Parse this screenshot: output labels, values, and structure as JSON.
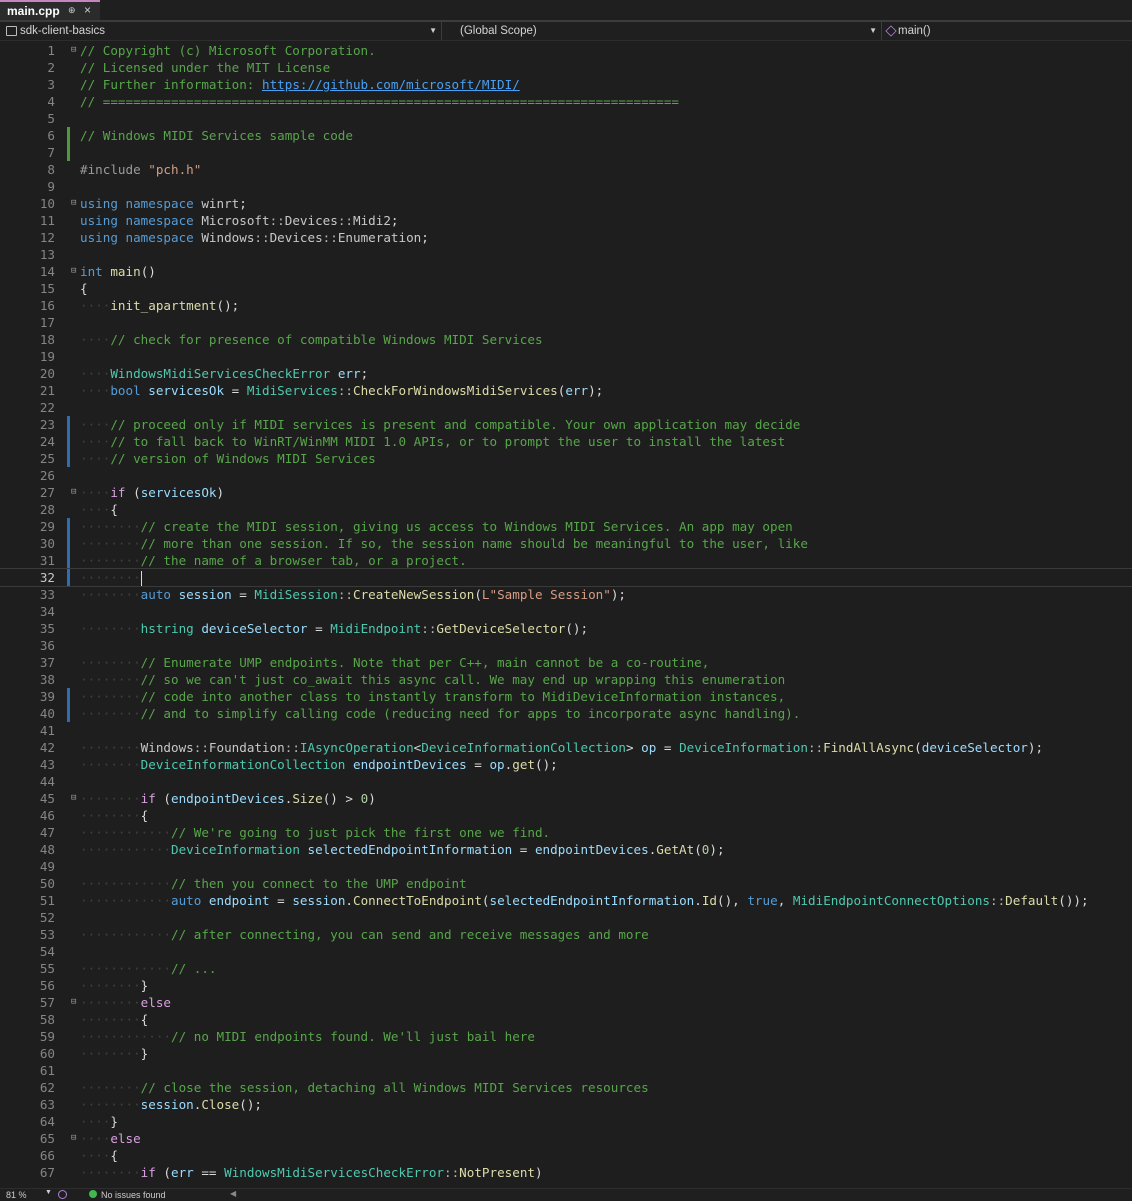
{
  "tab": {
    "title": "main.cpp",
    "pin": "⊕",
    "close": "×"
  },
  "nav": {
    "project": "sdk-client-basics",
    "scope": "(Global Scope)",
    "member": "main()"
  },
  "status": {
    "zoom": "81 %",
    "issues": "No issues found"
  },
  "colors": {
    "comment": "#57a64a",
    "keyword": "#569cd6",
    "control": "#d8a0df",
    "type": "#4ec9b0",
    "function": "#dcdcaa",
    "variable": "#9cdcfe",
    "string": "#d69d85"
  },
  "current_line": 32,
  "lines": [
    [
      [
        "cm",
        "// Copyright (c) Microsoft Corporation."
      ]
    ],
    [
      [
        "cm",
        "// Licensed under the MIT License"
      ]
    ],
    [
      [
        "cm",
        "// Further information: "
      ],
      [
        "link",
        "https://github.com/microsoft/MIDI/"
      ]
    ],
    [
      [
        "cm",
        "// ============================================================================"
      ]
    ],
    [],
    [
      [
        "cm",
        "// Windows MIDI Services sample code"
      ]
    ],
    [],
    [
      [
        "pp",
        "#include "
      ],
      [
        "str",
        "\"pch.h\""
      ]
    ],
    [],
    [
      [
        "kw",
        "using namespace "
      ],
      [
        "nsp",
        "winrt"
      ],
      [
        "plain",
        ";"
      ]
    ],
    [
      [
        "kw",
        "using namespace "
      ],
      [
        "nsp",
        "Microsoft"
      ],
      [
        "op",
        "::"
      ],
      [
        "nsp",
        "Devices"
      ],
      [
        "op",
        "::"
      ],
      [
        "nsp",
        "Midi2"
      ],
      [
        "plain",
        ";"
      ]
    ],
    [
      [
        "kw",
        "using namespace "
      ],
      [
        "nsp",
        "Windows"
      ],
      [
        "op",
        "::"
      ],
      [
        "nsp",
        "Devices"
      ],
      [
        "op",
        "::"
      ],
      [
        "nsp",
        "Enumeration"
      ],
      [
        "plain",
        ";"
      ]
    ],
    [],
    [
      [
        "kw",
        "int "
      ],
      [
        "fn",
        "main"
      ],
      [
        "plain",
        "()"
      ]
    ],
    [
      [
        "plain",
        "{"
      ]
    ],
    [
      [
        "ws",
        "    "
      ],
      [
        "fn",
        "init_apartment"
      ],
      [
        "plain",
        "();"
      ]
    ],
    [],
    [
      [
        "ws",
        "    "
      ],
      [
        "cm",
        "// check for presence of compatible Windows MIDI Services"
      ]
    ],
    [],
    [
      [
        "ws",
        "    "
      ],
      [
        "ty",
        "WindowsMidiServicesCheckError "
      ],
      [
        "var",
        "err"
      ],
      [
        "plain",
        ";"
      ]
    ],
    [
      [
        "ws",
        "    "
      ],
      [
        "kw",
        "bool "
      ],
      [
        "var",
        "servicesOk"
      ],
      [
        "plain",
        " = "
      ],
      [
        "ty",
        "MidiServices"
      ],
      [
        "op",
        "::"
      ],
      [
        "fn",
        "CheckForWindowsMidiServices"
      ],
      [
        "plain",
        "("
      ],
      [
        "var",
        "err"
      ],
      [
        "plain",
        ");"
      ]
    ],
    [],
    [
      [
        "ws",
        "    "
      ],
      [
        "cm",
        "// proceed only if MIDI services is present and compatible. Your own application may decide"
      ]
    ],
    [
      [
        "ws",
        "    "
      ],
      [
        "cm",
        "// to fall back to WinRT/WinMM MIDI 1.0 APIs, or to prompt the user to install the latest"
      ]
    ],
    [
      [
        "ws",
        "    "
      ],
      [
        "cm",
        "// version of Windows MIDI Services"
      ]
    ],
    [],
    [
      [
        "ws",
        "    "
      ],
      [
        "ctl",
        "if "
      ],
      [
        "plain",
        "("
      ],
      [
        "var",
        "servicesOk"
      ],
      [
        "plain",
        ")"
      ]
    ],
    [
      [
        "ws",
        "    "
      ],
      [
        "plain",
        "{"
      ]
    ],
    [
      [
        "ws",
        "        "
      ],
      [
        "cm",
        "// create the MIDI session, giving us access to Windows MIDI Services. An app may open"
      ]
    ],
    [
      [
        "ws",
        "        "
      ],
      [
        "cm",
        "// more than one session. If so, the session name should be meaningful to the user, like"
      ]
    ],
    [
      [
        "ws",
        "        "
      ],
      [
        "cm",
        "// the name of a browser tab, or a project."
      ]
    ],
    [
      [
        "ws",
        "        "
      ],
      [
        "caret",
        ""
      ]
    ],
    [
      [
        "ws",
        "        "
      ],
      [
        "kw",
        "auto "
      ],
      [
        "var",
        "session"
      ],
      [
        "plain",
        " = "
      ],
      [
        "ty",
        "MidiSession"
      ],
      [
        "op",
        "::"
      ],
      [
        "fn",
        "CreateNewSession"
      ],
      [
        "plain",
        "("
      ],
      [
        "str",
        "L\"Sample Session\""
      ],
      [
        "plain",
        ");"
      ]
    ],
    [],
    [
      [
        "ws",
        "        "
      ],
      [
        "ty",
        "hstring "
      ],
      [
        "var",
        "deviceSelector"
      ],
      [
        "plain",
        " = "
      ],
      [
        "ty",
        "MidiEndpoint"
      ],
      [
        "op",
        "::"
      ],
      [
        "fn",
        "GetDeviceSelector"
      ],
      [
        "plain",
        "();"
      ]
    ],
    [],
    [
      [
        "ws",
        "        "
      ],
      [
        "cm",
        "// Enumerate UMP endpoints. Note that per C++, main cannot be a co-routine,"
      ]
    ],
    [
      [
        "ws",
        "        "
      ],
      [
        "cm",
        "// so we can't just co_await this async call. We may end up wrapping this enumeration"
      ]
    ],
    [
      [
        "ws",
        "        "
      ],
      [
        "cm",
        "// code into another class to instantly transform to MidiDeviceInformation instances,"
      ]
    ],
    [
      [
        "ws",
        "        "
      ],
      [
        "cm",
        "// and to simplify calling code (reducing need for apps to incorporate async handling)."
      ]
    ],
    [],
    [
      [
        "ws",
        "        "
      ],
      [
        "nsp",
        "Windows"
      ],
      [
        "op",
        "::"
      ],
      [
        "nsp",
        "Foundation"
      ],
      [
        "op",
        "::"
      ],
      [
        "ty",
        "IAsyncOperation"
      ],
      [
        "plain",
        "<"
      ],
      [
        "ty",
        "DeviceInformationCollection"
      ],
      [
        "plain",
        "> "
      ],
      [
        "var",
        "op"
      ],
      [
        "plain",
        " = "
      ],
      [
        "ty",
        "DeviceInformation"
      ],
      [
        "op",
        "::"
      ],
      [
        "fn",
        "FindAllAsync"
      ],
      [
        "plain",
        "("
      ],
      [
        "var",
        "deviceSelector"
      ],
      [
        "plain",
        ");"
      ]
    ],
    [
      [
        "ws",
        "        "
      ],
      [
        "ty",
        "DeviceInformationCollection "
      ],
      [
        "var",
        "endpointDevices"
      ],
      [
        "plain",
        " = "
      ],
      [
        "var",
        "op"
      ],
      [
        "plain",
        "."
      ],
      [
        "fn",
        "get"
      ],
      [
        "plain",
        "();"
      ]
    ],
    [],
    [
      [
        "ws",
        "        "
      ],
      [
        "ctl",
        "if "
      ],
      [
        "plain",
        "("
      ],
      [
        "var",
        "endpointDevices"
      ],
      [
        "plain",
        "."
      ],
      [
        "fn",
        "Size"
      ],
      [
        "plain",
        "() > "
      ],
      [
        "num",
        "0"
      ],
      [
        "plain",
        ")"
      ]
    ],
    [
      [
        "ws",
        "        "
      ],
      [
        "plain",
        "{"
      ]
    ],
    [
      [
        "ws",
        "            "
      ],
      [
        "cm",
        "// We're going to just pick the first one we find."
      ]
    ],
    [
      [
        "ws",
        "            "
      ],
      [
        "ty",
        "DeviceInformation "
      ],
      [
        "var",
        "selectedEndpointInformation"
      ],
      [
        "plain",
        " = "
      ],
      [
        "var",
        "endpointDevices"
      ],
      [
        "plain",
        "."
      ],
      [
        "fn",
        "GetAt"
      ],
      [
        "plain",
        "("
      ],
      [
        "num",
        "0"
      ],
      [
        "plain",
        ");"
      ]
    ],
    [],
    [
      [
        "ws",
        "            "
      ],
      [
        "cm",
        "// then you connect to the UMP endpoint"
      ]
    ],
    [
      [
        "ws",
        "            "
      ],
      [
        "kw",
        "auto "
      ],
      [
        "var",
        "endpoint"
      ],
      [
        "plain",
        " = "
      ],
      [
        "var",
        "session"
      ],
      [
        "plain",
        "."
      ],
      [
        "fn",
        "ConnectToEndpoint"
      ],
      [
        "plain",
        "("
      ],
      [
        "var",
        "selectedEndpointInformation"
      ],
      [
        "plain",
        "."
      ],
      [
        "fn",
        "Id"
      ],
      [
        "plain",
        "(), "
      ],
      [
        "kw",
        "true"
      ],
      [
        "plain",
        ", "
      ],
      [
        "ty",
        "MidiEndpointConnectOptions"
      ],
      [
        "op",
        "::"
      ],
      [
        "fn",
        "Default"
      ],
      [
        "plain",
        "());"
      ]
    ],
    [],
    [
      [
        "ws",
        "            "
      ],
      [
        "cm",
        "// after connecting, you can send and receive messages and more"
      ]
    ],
    [],
    [
      [
        "ws",
        "            "
      ],
      [
        "cm",
        "// ..."
      ]
    ],
    [
      [
        "ws",
        "        "
      ],
      [
        "plain",
        "}"
      ]
    ],
    [
      [
        "ws",
        "        "
      ],
      [
        "ctl",
        "else"
      ]
    ],
    [
      [
        "ws",
        "        "
      ],
      [
        "plain",
        "{"
      ]
    ],
    [
      [
        "ws",
        "            "
      ],
      [
        "cm",
        "// no MIDI endpoints found. We'll just bail here"
      ]
    ],
    [
      [
        "ws",
        "        "
      ],
      [
        "plain",
        "}"
      ]
    ],
    [],
    [
      [
        "ws",
        "        "
      ],
      [
        "cm",
        "// close the session, detaching all Windows MIDI Services resources"
      ]
    ],
    [
      [
        "ws",
        "        "
      ],
      [
        "var",
        "session"
      ],
      [
        "plain",
        "."
      ],
      [
        "fn",
        "Close"
      ],
      [
        "plain",
        "();"
      ]
    ],
    [
      [
        "ws",
        "    "
      ],
      [
        "plain",
        "}"
      ]
    ],
    [
      [
        "ws",
        "    "
      ],
      [
        "ctl",
        "else"
      ]
    ],
    [
      [
        "ws",
        "    "
      ],
      [
        "plain",
        "{"
      ]
    ],
    [
      [
        "ws",
        "        "
      ],
      [
        "ctl",
        "if "
      ],
      [
        "plain",
        "("
      ],
      [
        "var",
        "err"
      ],
      [
        "plain",
        " == "
      ],
      [
        "ty",
        "WindowsMidiServicesCheckError"
      ],
      [
        "op",
        "::"
      ],
      [
        "fn",
        "NotPresent"
      ],
      [
        "plain",
        ")"
      ]
    ]
  ]
}
